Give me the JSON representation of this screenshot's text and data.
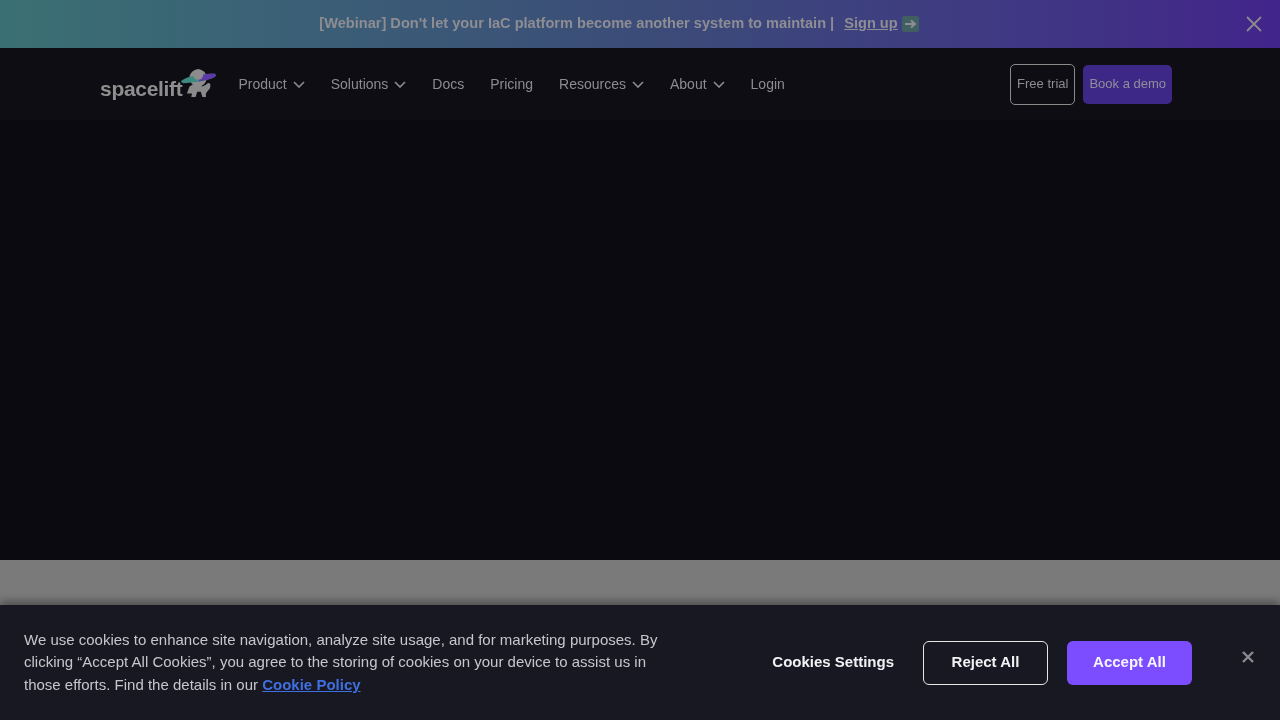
{
  "announcement": {
    "text": "[Webinar] Don't let your IaC platform become another system to maintain |",
    "link": "Sign up"
  },
  "nav": {
    "logo": "spacelift",
    "items": [
      {
        "label": "Product",
        "dropdown": true
      },
      {
        "label": "Solutions",
        "dropdown": true
      },
      {
        "label": "Docs",
        "dropdown": false
      },
      {
        "label": "Pricing",
        "dropdown": false
      },
      {
        "label": "Resources",
        "dropdown": true
      },
      {
        "label": "About",
        "dropdown": true
      },
      {
        "label": "Login",
        "dropdown": false
      }
    ],
    "buttons": [
      {
        "label": "Free trial",
        "kind": "outline"
      },
      {
        "label": "Book a demo",
        "kind": "filled"
      }
    ]
  },
  "cookie_banner": {
    "text": "We use cookies to enhance site navigation, analyze site usage, and for marketing purposes. By clicking “Accept All Cookies”, you agree to the storing of cookies on your device to assist us in those efforts. Find the details in our",
    "link": "Cookie Policy",
    "buttons": [
      {
        "label": "Cookies Settings",
        "kind": "text"
      },
      {
        "label": "Reject All",
        "kind": "outline"
      },
      {
        "label": "Accept All",
        "kind": "filled"
      }
    ]
  }
}
